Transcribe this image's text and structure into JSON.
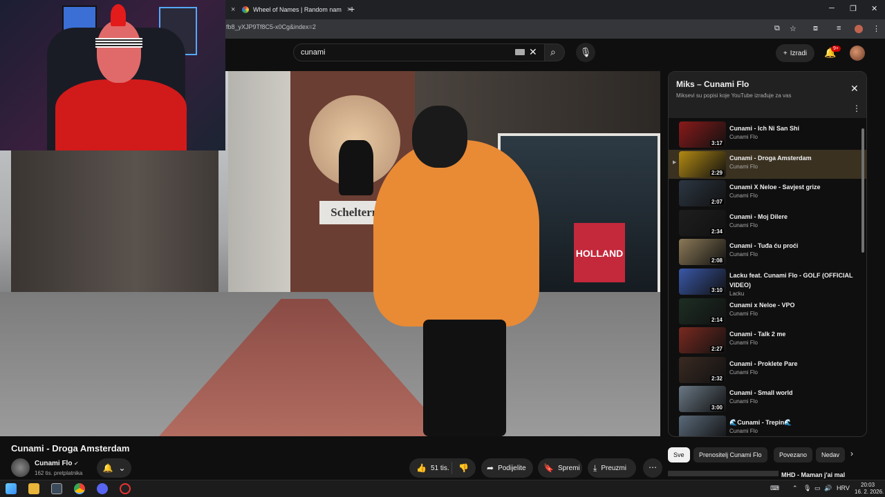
{
  "browser": {
    "tab1_close": "×",
    "tab2_title": "Wheel of Names | Random nam",
    "tab2_close": "×",
    "new_tab": "+",
    "url": "fb8_yXJP9Tf8C5-x0Cg&index=2",
    "window": {
      "minimize": "─",
      "maximize": "❐",
      "close": "✕"
    }
  },
  "masthead": {
    "search_value": "cunami",
    "clear": "✕",
    "search_icon": "⌕",
    "mic_icon": "🎙",
    "create_label": "Izradi",
    "create_icon": "+",
    "bell_icon": "🔔",
    "notif_badge": "9+"
  },
  "video": {
    "title": "Cunami - Droga Amsterdam",
    "sign_text": "Schelterna",
    "shop_sign": "HOLLAND",
    "channel": "Cunami Flo",
    "verified_icon": "✔",
    "subscribers": "162 tis. pretplatnika",
    "bell_icon": "🔔",
    "chevron": "⌄",
    "likes": "51 tis.",
    "like_icon": "👍",
    "dislike_icon": "👎",
    "share_label": "Podijelite",
    "share_icon": "➦",
    "save_label": "Spremi",
    "save_icon": "🔖",
    "download_label": "Preuzmi",
    "download_icon": "⤓",
    "more_icon": "⋯"
  },
  "playlist": {
    "title": "Miks – Cunami Flo",
    "subtitle": "Miksevi su popisi koje YouTube izrađuje za vas",
    "close_icon": "✕",
    "menu_icon": "⋮",
    "active_marker": "▶",
    "items": [
      {
        "title": "Cunami - Ich Ni San Shi",
        "channel": "Cunami Flo",
        "duration": "3:17",
        "thumb": "#8a1a1a"
      },
      {
        "title": "Cunami - Droga Amsterdam",
        "channel": "Cunami Flo",
        "duration": "2:29",
        "thumb": "#b38a12"
      },
      {
        "title": "Cunami X Neloe - Savjest grize",
        "channel": "Cunami Flo",
        "duration": "2:07",
        "thumb": "#2c3642"
      },
      {
        "title": "Cunami - Moj Dilere",
        "channel": "Cunami Flo",
        "duration": "2:34",
        "thumb": "#1e1e1e"
      },
      {
        "title": "Cunami - Tuđa ću proći",
        "channel": "Cunami Flo",
        "duration": "2:08",
        "thumb": "#8c7a58"
      },
      {
        "title": "Lacku feat. Cunami Flo - GOLF (OFFICIAL VIDEO)",
        "channel": "Lacku",
        "duration": "3:10",
        "thumb": "#3a58a8"
      },
      {
        "title": "Cunami x Neloe - VPO",
        "channel": "Cunami Flo",
        "duration": "2:14",
        "thumb": "#1d2e24"
      },
      {
        "title": "Cunami - Talk 2 me",
        "channel": "Cunami Flo",
        "duration": "2:27",
        "thumb": "#7a2a20"
      },
      {
        "title": "Cunami - Proklete Pare",
        "channel": "Cunami Flo",
        "duration": "2:32",
        "thumb": "#3a2a22"
      },
      {
        "title": "Cunami - Small world",
        "channel": "Cunami Flo",
        "duration": "3:00",
        "thumb": "#6a7885"
      },
      {
        "title": "🌊Cunami - Trepin🌊",
        "channel": "Cunami Flo",
        "duration": "",
        "thumb": "#5a6a7a"
      }
    ]
  },
  "chips": [
    "Sve",
    "Prenositelj Cunami Flo",
    "Povezano",
    "Nedav"
  ],
  "chip_next": "›",
  "next_video_title": "MHD - Maman j'ai mal",
  "taskbar": {
    "lang": "HRV",
    "time": "20:03",
    "date": "16. 2. 2026."
  }
}
